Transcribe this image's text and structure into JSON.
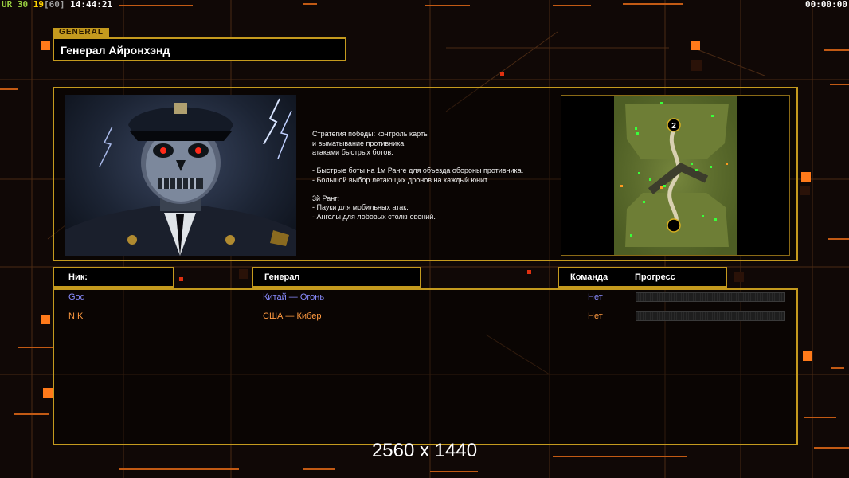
{
  "hud": {
    "ur_label": "UR",
    "ur_value": "30",
    "fps": "19",
    "fps_limit": "[60]",
    "clock": "14:44:21",
    "timer": "00:00:00"
  },
  "general": {
    "tab_label": "GENERAL",
    "name": "Генерал Айронхэнд",
    "description": [
      "Стратегия победы: контроль карты",
      "и выматывание противника",
      "атаками быстрых ботов.",
      "",
      "- Быстрые боты на 1м Ранге для объезда обороны противника.",
      "- Большой выбор летающих дронов на каждый юнит.",
      "",
      "3й Ранг:",
      "- Пауки для мобильных атак.",
      "- Ангелы для лобовых столкновений."
    ]
  },
  "minimap": {
    "start_marker": "2"
  },
  "table": {
    "headers": {
      "nick": "Ник:",
      "general": "Генерал",
      "team": "Команда",
      "progress": "Прогресс"
    },
    "rows": [
      {
        "nick": "God",
        "general": "Китай — Огонь",
        "team": "Нет",
        "color": "#8a8cff",
        "progress": 0
      },
      {
        "nick": "NIK",
        "general": "США — Кибер",
        "team": "Нет",
        "color": "#ff9a40",
        "progress": 0
      }
    ]
  },
  "overlay": {
    "resolution": "2560 x 1440"
  },
  "colors": {
    "accent_gold": "#c49a1e",
    "accent_orange": "#ff7a1a"
  }
}
